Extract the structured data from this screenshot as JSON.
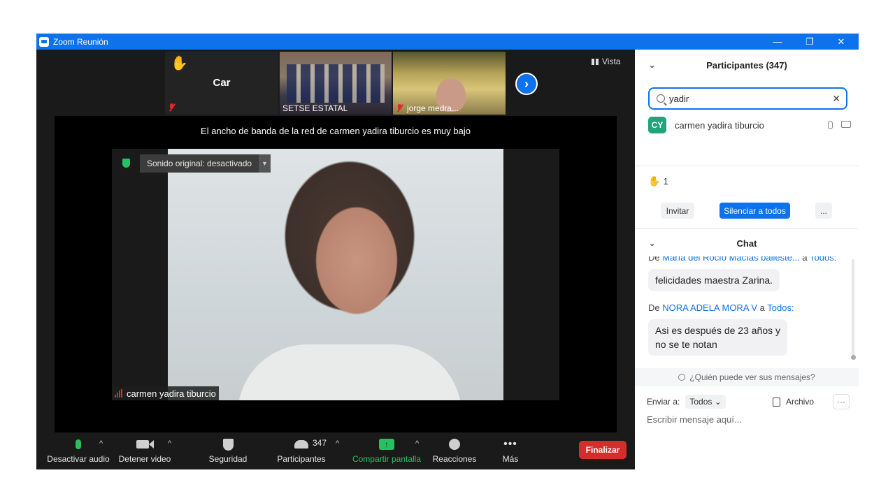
{
  "window": {
    "title": "Zoom Reunión",
    "controls": {
      "minimize": "—",
      "restore": "❐",
      "close": "✕"
    }
  },
  "thumbnails": [
    {
      "label": "Car",
      "raised_hand": "✋"
    },
    {
      "label": "SETSE ESTATAL"
    },
    {
      "label": "jorge medra..."
    }
  ],
  "view_button": "Vista",
  "bandwidth_warning": "El ancho de banda de la red de carmen yadira  tiburcio es muy bajo",
  "original_sound": "Sonido original: desactivado",
  "speaker_name": "carmen yadira  tiburcio",
  "toolbar": {
    "audio": "Desactivar audio",
    "video": "Detener video",
    "security": "Seguridad",
    "participants": "Participantes",
    "participants_count": "347",
    "share": "Compartir pantalla",
    "reactions": "Reacciones",
    "more": "Más",
    "end": "Finalizar"
  },
  "participants_panel": {
    "title": "Participantes (347)",
    "search_value": "yadir",
    "results": [
      {
        "initials": "CY",
        "name": "carmen yadira  tiburcio"
      }
    ],
    "raised_hands": "1",
    "invite": "Invitar",
    "mute_all": "Silenciar a todos",
    "more": "..."
  },
  "chat": {
    "title": "Chat",
    "messages": [
      {
        "from_prefix": "De ",
        "sender": "María del Rocío Macías balleste...",
        "to_prefix": " a ",
        "to": "Todos:",
        "text": "felicidades maestra Zarina."
      },
      {
        "from_prefix": "De ",
        "sender": "NORA ADELA MORA V",
        "to_prefix": " a ",
        "to": "Todos:",
        "text_lines": [
          "Asi es después de 23  años y",
          "no se te notan"
        ]
      }
    ],
    "who_can_see": "¿Quién puede ver sus mensajes?",
    "send_to_label": "Enviar a:",
    "send_to_value": "Todos",
    "file_label": "Archivo",
    "input_placeholder": "Escribir mensaje aquí..."
  },
  "colors": {
    "accent": "#0e72ed",
    "end_button": "#d72c2c",
    "share_green": "#25c265",
    "avatar_green": "#23a37a"
  }
}
